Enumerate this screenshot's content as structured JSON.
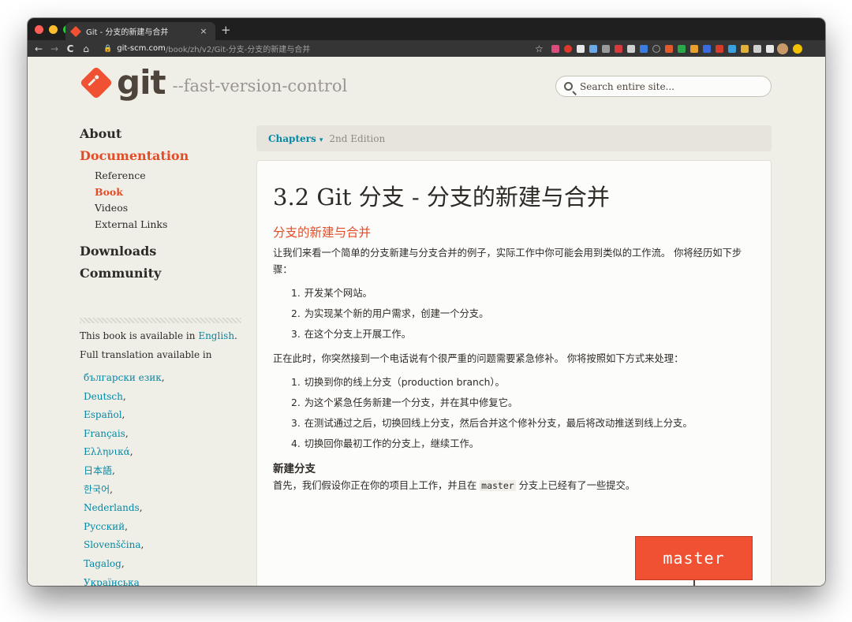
{
  "browser": {
    "tab_title": "Git - 分支的新建与合并",
    "tab_close": "×",
    "new_tab": "+",
    "back": "←",
    "forward": "→",
    "reload": "C",
    "home": "⌂",
    "url_host": "git-scm.com",
    "url_path": "/book/zh/v2/Git-分支-分支的新建与合并",
    "star": "☆",
    "colors": {
      "close": "#ff5f57",
      "minimize": "#febc2e",
      "zoom": "#28c840"
    }
  },
  "header": {
    "logo_word": "git",
    "logo_tagline": "--fast-version-control",
    "search_placeholder": "Search entire site..."
  },
  "sidebar": {
    "main_items": [
      "About",
      "Documentation"
    ],
    "doc_subitems": [
      "Reference",
      "Book",
      "Videos",
      "External Links"
    ],
    "bottom_items": [
      "Downloads",
      "Community"
    ],
    "avail_prefix": "This book is available in ",
    "avail_link": "English",
    "avail_suffix": ".",
    "full_translation": "Full translation available in",
    "languages": [
      "български език",
      "Deutsch",
      "Español",
      "Français",
      "Ελληνικά",
      "日本語",
      "한국어",
      "Nederlands",
      "Русский",
      "Slovenščina",
      "Tagalog",
      "Українська"
    ]
  },
  "chapter_bar": {
    "chapters_label": "Chapters",
    "caret": "▾",
    "edition": "2nd Edition"
  },
  "content": {
    "title": "3.2 Git 分支 - 分支的新建与合并",
    "section_heading": "分支的新建与合并",
    "intro": "让我们来看一个简单的分支新建与分支合并的例子，实际工作中你可能会用到类似的工作流。 你将经历如下步骤：",
    "steps1": [
      "开发某个网站。",
      "为实现某个新的用户需求，创建一个分支。",
      "在这个分支上开展工作。"
    ],
    "middle": "正在此时，你突然接到一个电话说有个很严重的问题需要紧急修补。 你将按照如下方式来处理：",
    "steps2": [
      "切换到你的线上分支（production branch）。",
      "为这个紧急任务新建一个分支，并在其中修复它。",
      "在测试通过之后，切换回线上分支，然后合并这个修补分支，最后将改动推送到线上分支。",
      "切换回你最初工作的分支上，继续工作。"
    ],
    "subheading": "新建分支",
    "para_before_code": "首先，我们假设你正在你的项目上工作，并且在 ",
    "code": "master",
    "para_after_code": " 分支上已经有了一些提交。",
    "diagram_label": "master"
  }
}
